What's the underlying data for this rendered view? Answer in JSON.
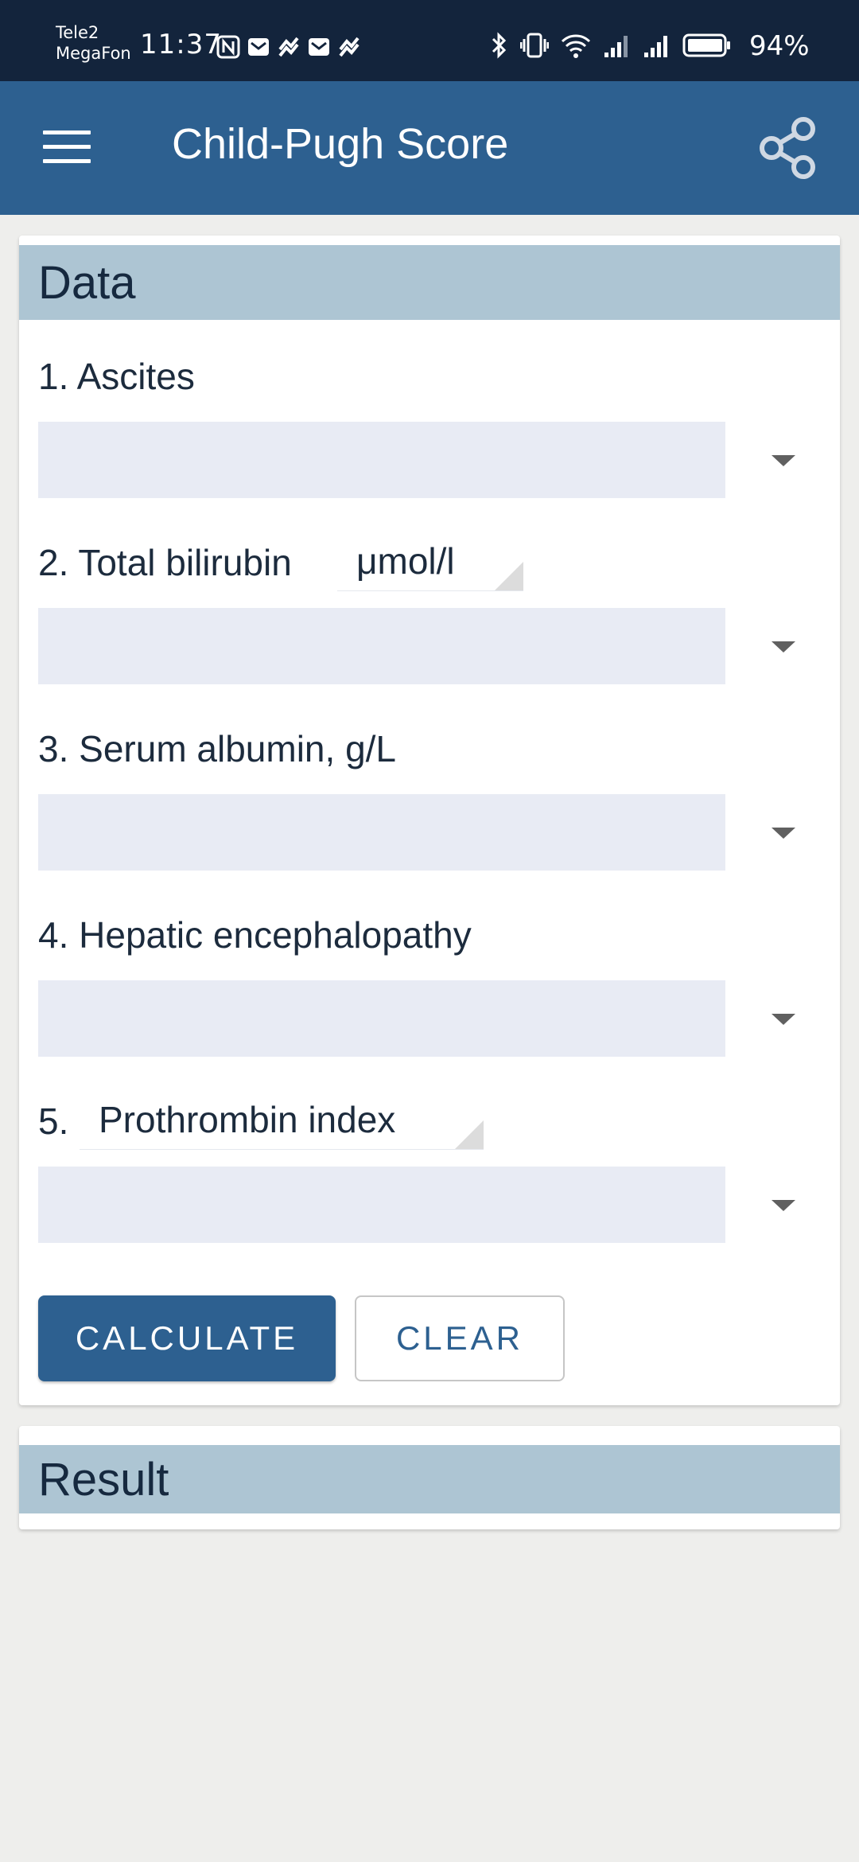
{
  "status_bar": {
    "carrier_line1": "Tele2",
    "carrier_line2": "MegaFon",
    "time": "11:37",
    "battery_percent": "94%",
    "notification_icons": [
      "nfc-icon",
      "mail-icon",
      "swirl-icon",
      "mail-icon",
      "swirl-icon"
    ],
    "system_icons": [
      "bluetooth-icon",
      "vibrate-icon",
      "wifi-icon",
      "signal-icon",
      "signal-icon",
      "battery-icon"
    ]
  },
  "app_bar": {
    "title": "Child-Pugh Score",
    "menu_icon": "menu-icon",
    "share_icon": "share-icon",
    "background": "#2d6090"
  },
  "data_card": {
    "title": "Data",
    "fields": [
      {
        "number": "1.",
        "label": "Ascites",
        "value": ""
      },
      {
        "number": "2.",
        "label": "Total bilirubin",
        "unit": "μmol/l",
        "value": ""
      },
      {
        "number": "3.",
        "label": "Serum albumin, g/L",
        "value": ""
      },
      {
        "number": "4.",
        "label": "Hepatic encephalopathy",
        "value": ""
      },
      {
        "number": "5.",
        "label": "Prothrombin index",
        "value": ""
      }
    ],
    "calculate_label": "CALCULATE",
    "clear_label": "CLEAR"
  },
  "result_card": {
    "title": "Result"
  },
  "colors": {
    "primary": "#2d6090",
    "status_bar": "#13243c",
    "card_header": "#adc5d3",
    "dropdown_bg": "#e8ebf4"
  }
}
